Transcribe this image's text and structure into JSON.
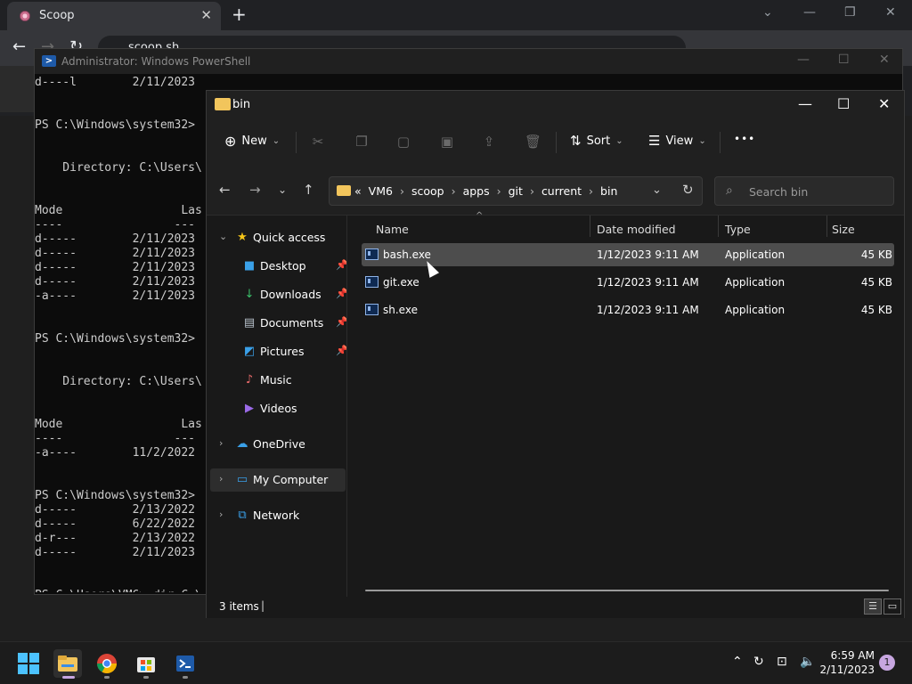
{
  "browser": {
    "tab_title": "Scoop",
    "tab_close": "✕",
    "new_tab": "+",
    "url": "scoop.sh"
  },
  "powershell": {
    "title": "Administrator: Windows PowerShell",
    "lines": [
      "d----l        2/11/2023   6:46 AM                current",
      "",
      "",
      "PS C:\\Windows\\system32>",
      "",
      "",
      "    Directory: C:\\Users\\",
      "",
      "",
      "Mode                 Las",
      "----                ---",
      "d-----        2/11/2023",
      "d-----        2/11/2023",
      "d-----        2/11/2023",
      "d-----        2/11/2023",
      "-a----        2/11/2023",
      "",
      "",
      "PS C:\\Windows\\system32>",
      "",
      "",
      "    Directory: C:\\Users\\",
      "",
      "",
      "Mode                 Las",
      "----                ---",
      "-a----        11/2/2022",
      "",
      "",
      "PS C:\\Windows\\system32>",
      "d-----        2/13/2022",
      "d-----        6/22/2022",
      "d-r---        2/13/2022",
      "d-----        2/11/2023",
      "",
      "",
      "PS C:\\Users\\VM6> dir C:\\"
    ]
  },
  "explorer": {
    "title": "bin",
    "commands": {
      "new": "New",
      "sort": "Sort",
      "view": "View",
      "more": "•••"
    },
    "breadcrumb": [
      "«",
      "VM6",
      "scoop",
      "apps",
      "git",
      "current",
      "bin"
    ],
    "search_placeholder": "Search bin",
    "nav": [
      {
        "label": "Quick access",
        "icon": "star-icon",
        "glyph": "★",
        "color": "#f5c518",
        "level": 0,
        "expander": "⌄",
        "pinned": false
      },
      {
        "label": "Desktop",
        "icon": "desktop-icon",
        "glyph": "■",
        "color": "#3aa0e8",
        "level": 1,
        "pinned": true
      },
      {
        "label": "Downloads",
        "icon": "download-icon",
        "glyph": "↓",
        "color": "#3bbf6a",
        "level": 1,
        "pinned": true
      },
      {
        "label": "Documents",
        "icon": "document-icon",
        "glyph": "▤",
        "color": "#b8c2cc",
        "level": 1,
        "pinned": true
      },
      {
        "label": "Pictures",
        "icon": "pictures-icon",
        "glyph": "◩",
        "color": "#3aa0e8",
        "level": 1,
        "pinned": true
      },
      {
        "label": "Music",
        "icon": "music-icon",
        "glyph": "♪",
        "color": "#e86a6a",
        "level": 1,
        "pinned": false
      },
      {
        "label": "Videos",
        "icon": "video-icon",
        "glyph": "▶",
        "color": "#9b6ae8",
        "level": 1,
        "pinned": false
      },
      {
        "label": "OneDrive",
        "icon": "cloud-icon",
        "glyph": "☁",
        "color": "#3aa0e8",
        "level": 0,
        "expander": "›",
        "pinned": false
      },
      {
        "label": "My Computer",
        "icon": "computer-icon",
        "glyph": "▭",
        "color": "#3aa0e8",
        "level": 0,
        "expander": "›",
        "pinned": false
      },
      {
        "label": "Network",
        "icon": "network-icon",
        "glyph": "⧉",
        "color": "#3aa0e8",
        "level": 0,
        "expander": "›",
        "pinned": false
      }
    ],
    "columns": {
      "name": "Name",
      "date": "Date modified",
      "type": "Type",
      "size": "Size"
    },
    "files": [
      {
        "name": "bash.exe",
        "date": "1/12/2023 9:11 AM",
        "type": "Application",
        "size": "45 KB"
      },
      {
        "name": "git.exe",
        "date": "1/12/2023 9:11 AM",
        "type": "Application",
        "size": "45 KB"
      },
      {
        "name": "sh.exe",
        "date": "1/12/2023 9:11 AM",
        "type": "Application",
        "size": "45 KB"
      }
    ],
    "status_count": "3 items",
    "status_caret": "|"
  },
  "taskbar": {
    "time": "6:59 AM",
    "date": "2/11/2023",
    "notifications": "1"
  }
}
